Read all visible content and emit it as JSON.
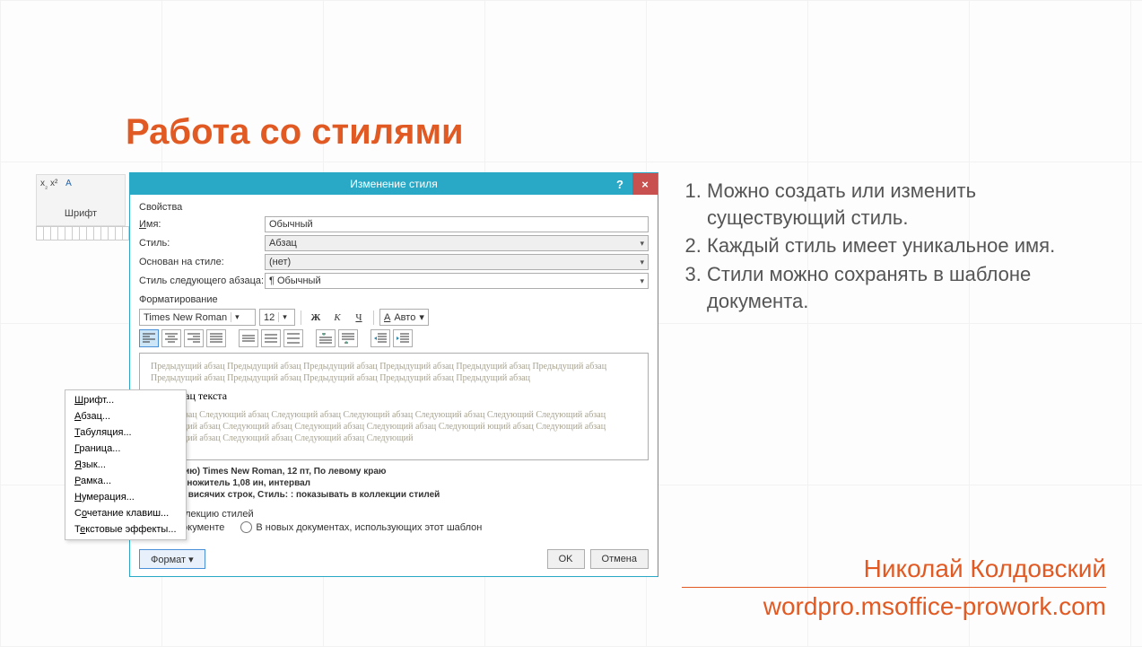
{
  "slide": {
    "title": "Работа со стилями",
    "bullets": [
      "Можно создать или изменить существующий стиль.",
      "Каждый стиль имеет уникальное имя.",
      "Стили можно сохранять в шаблоне документа."
    ],
    "author": "Николай Колдовский",
    "url": "wordpro.msoffice-prowork.com"
  },
  "ribbon": {
    "group_label": "Шрифт"
  },
  "dialog": {
    "title": "Изменение стиля",
    "section_props": "Свойства",
    "name_label": "Имя:",
    "name_value": "Обычный",
    "style_label": "Стиль:",
    "style_value": "Абзац",
    "based_label": "Основан на стиле:",
    "based_value": "(нет)",
    "next_label": "Стиль следующего абзаца:",
    "next_value": "¶ Обычный",
    "section_format": "Форматирование",
    "font_name": "Times New Roman",
    "font_size": "12",
    "bold": "Ж",
    "italic": "К",
    "underline": "Ч",
    "color_label": "Авто",
    "preview_prev": "Предыдущий абзац Предыдущий абзац Предыдущий абзац Предыдущий абзац Предыдущий абзац Предыдущий абзац Предыдущий абзац Предыдущий абзац Предыдущий абзац Предыдущий абзац Предыдущий абзац",
    "preview_sample": "дин абзац текста",
    "preview_next": "ющий абзац Следующий абзац Следующий абзац Следующий абзац Следующий абзац Следующий Следующий абзац Следующий абзац Следующий абзац Следующий абзац Следующий абзац Следующий ющий абзац Следующий абзац Следующий абзац Следующий абзац Следующий абзац Следующий",
    "desc_line1": "умолчанию) Times New Roman, 12 пт, По левому краю",
    "desc_line2": "очный,  множитель 1,08 ин, интервал",
    "desc_line3": "т, Запрет висячих строк, Стиль: : показывать в коллекции стилей",
    "chk_collection": "в коллекцию стилей",
    "radio_thisdoc": "ом документе",
    "radio_newdocs": "В новых документах, использующих этот шаблон",
    "btn_format": "Формат ▾",
    "btn_ok": "OK",
    "btn_cancel": "Отмена"
  },
  "ctxmenu": {
    "items": [
      {
        "pre": "",
        "u": "Ш",
        "post": "рифт..."
      },
      {
        "pre": "",
        "u": "А",
        "post": "бзац..."
      },
      {
        "pre": "",
        "u": "Т",
        "post": "абуляция..."
      },
      {
        "pre": "",
        "u": "Г",
        "post": "раница..."
      },
      {
        "pre": "",
        "u": "Я",
        "post": "зык..."
      },
      {
        "pre": "",
        "u": "Р",
        "post": "амка..."
      },
      {
        "pre": "",
        "u": "Н",
        "post": "умерация..."
      },
      {
        "pre": "С",
        "u": "о",
        "post": "четание клавиш..."
      },
      {
        "pre": "Т",
        "u": "е",
        "post": "кстовые эффекты..."
      }
    ]
  }
}
